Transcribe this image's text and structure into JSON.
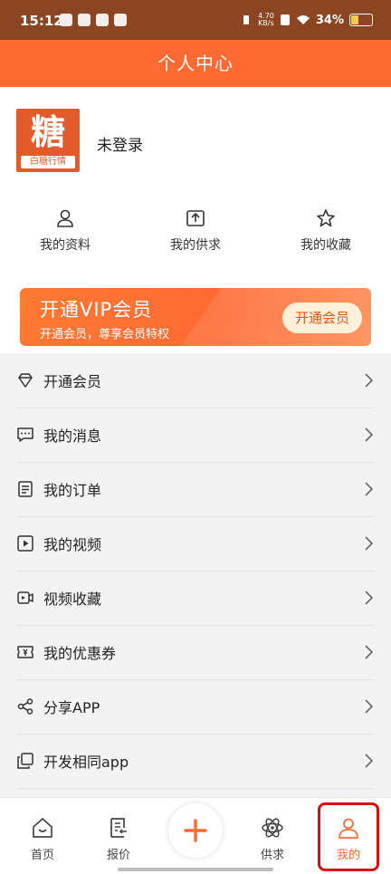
{
  "status": {
    "time": "15:12",
    "net": "4.70\nKB/s",
    "battery": "34%"
  },
  "header": {
    "title": "个人中心"
  },
  "profile": {
    "logo_big": "糖",
    "logo_small": "白糖行情",
    "login": "未登录"
  },
  "quick": [
    {
      "label": "我的资料",
      "icon": "user-icon"
    },
    {
      "label": "我的供求",
      "icon": "upload-icon"
    },
    {
      "label": "我的收藏",
      "icon": "star-icon"
    }
  ],
  "vip": {
    "title": "开通VIP会员",
    "subtitle": "开通会员，尊享会员特权",
    "button": "开通会员"
  },
  "menu": [
    {
      "label": "开通会员",
      "icon": "diamond-icon"
    },
    {
      "label": "我的消息",
      "icon": "message-icon"
    },
    {
      "label": "我的订单",
      "icon": "order-icon"
    },
    {
      "label": "我的视频",
      "icon": "video-icon"
    },
    {
      "label": "视频收藏",
      "icon": "video-collect-icon"
    },
    {
      "label": "我的优惠券",
      "icon": "coupon-icon"
    },
    {
      "label": "分享APP",
      "icon": "share-icon"
    },
    {
      "label": "开发相同app",
      "icon": "copy-icon"
    }
  ],
  "tabs": [
    {
      "label": "首页",
      "icon": "home-icon"
    },
    {
      "label": "报价",
      "icon": "quote-icon"
    },
    {
      "label": "",
      "icon": "plus-icon"
    },
    {
      "label": "供求",
      "icon": "atom-icon"
    },
    {
      "label": "我的",
      "icon": "profile-icon"
    }
  ],
  "colors": {
    "accent": "#ff6a33",
    "statusbar": "#8b4522",
    "highlight": "#d80d0d"
  }
}
